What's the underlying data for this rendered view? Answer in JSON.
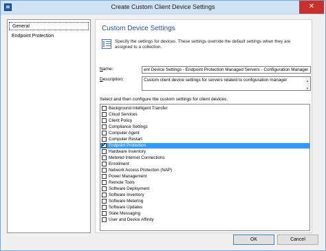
{
  "window": {
    "title": "Create Custom Client Device Settings",
    "close_glyph": "✕"
  },
  "nav": {
    "items": [
      {
        "label": "General",
        "selected": true
      },
      {
        "label": "Endpoint Protection",
        "selected": false
      }
    ]
  },
  "main": {
    "heading": "Custom Device Settings",
    "info_text": "Specify the settings for devices. These settings override the default settings when they are assigned to a collection.",
    "name_label_u": "N",
    "name_label_rest": "ame:",
    "name_value": "ent Device Settings - Endpoint Protection Managed Servers - Configuration Manager",
    "desc_label_u": "D",
    "desc_label_rest": "escription:",
    "desc_value": "Custom client device settings for servers related to configuration manager",
    "select_label": "Select and then configure the custom settings for client devices."
  },
  "settings_list": [
    {
      "label": "Background Intelligent Transfer",
      "checked": false,
      "selected": false
    },
    {
      "label": "Cloud Services",
      "checked": false,
      "selected": false
    },
    {
      "label": "Client Policy",
      "checked": false,
      "selected": false
    },
    {
      "label": "Compliance Settings",
      "checked": false,
      "selected": false
    },
    {
      "label": "Computer Agent",
      "checked": false,
      "selected": false
    },
    {
      "label": "Computer Restart",
      "checked": false,
      "selected": false
    },
    {
      "label": "Endpoint Protection",
      "checked": true,
      "selected": true
    },
    {
      "label": "Hardware Inventory",
      "checked": false,
      "selected": false
    },
    {
      "label": "Metered Internet Connections",
      "checked": false,
      "selected": false
    },
    {
      "label": "Enrollment",
      "checked": false,
      "selected": false
    },
    {
      "label": "Network Access Protection (NAP)",
      "checked": false,
      "selected": false
    },
    {
      "label": "Power Management",
      "checked": false,
      "selected": false
    },
    {
      "label": "Remote Tools",
      "checked": false,
      "selected": false
    },
    {
      "label": "Software Deployment",
      "checked": false,
      "selected": false
    },
    {
      "label": "Software Inventory",
      "checked": false,
      "selected": false
    },
    {
      "label": "Software Metering",
      "checked": false,
      "selected": false
    },
    {
      "label": "Software Updates",
      "checked": false,
      "selected": false
    },
    {
      "label": "State Messaging",
      "checked": false,
      "selected": false
    },
    {
      "label": "User and Device Affinity",
      "checked": false,
      "selected": false
    }
  ],
  "buttons": {
    "ok": "OK",
    "cancel": "Cancel"
  },
  "colors": {
    "selection": "#3399ff",
    "heading": "#1f4f99",
    "close": "#c9302c"
  },
  "icons": {
    "app": "app-icon",
    "info": "settings-list-icon",
    "close": "close-icon",
    "check": "checkmark-icon"
  }
}
